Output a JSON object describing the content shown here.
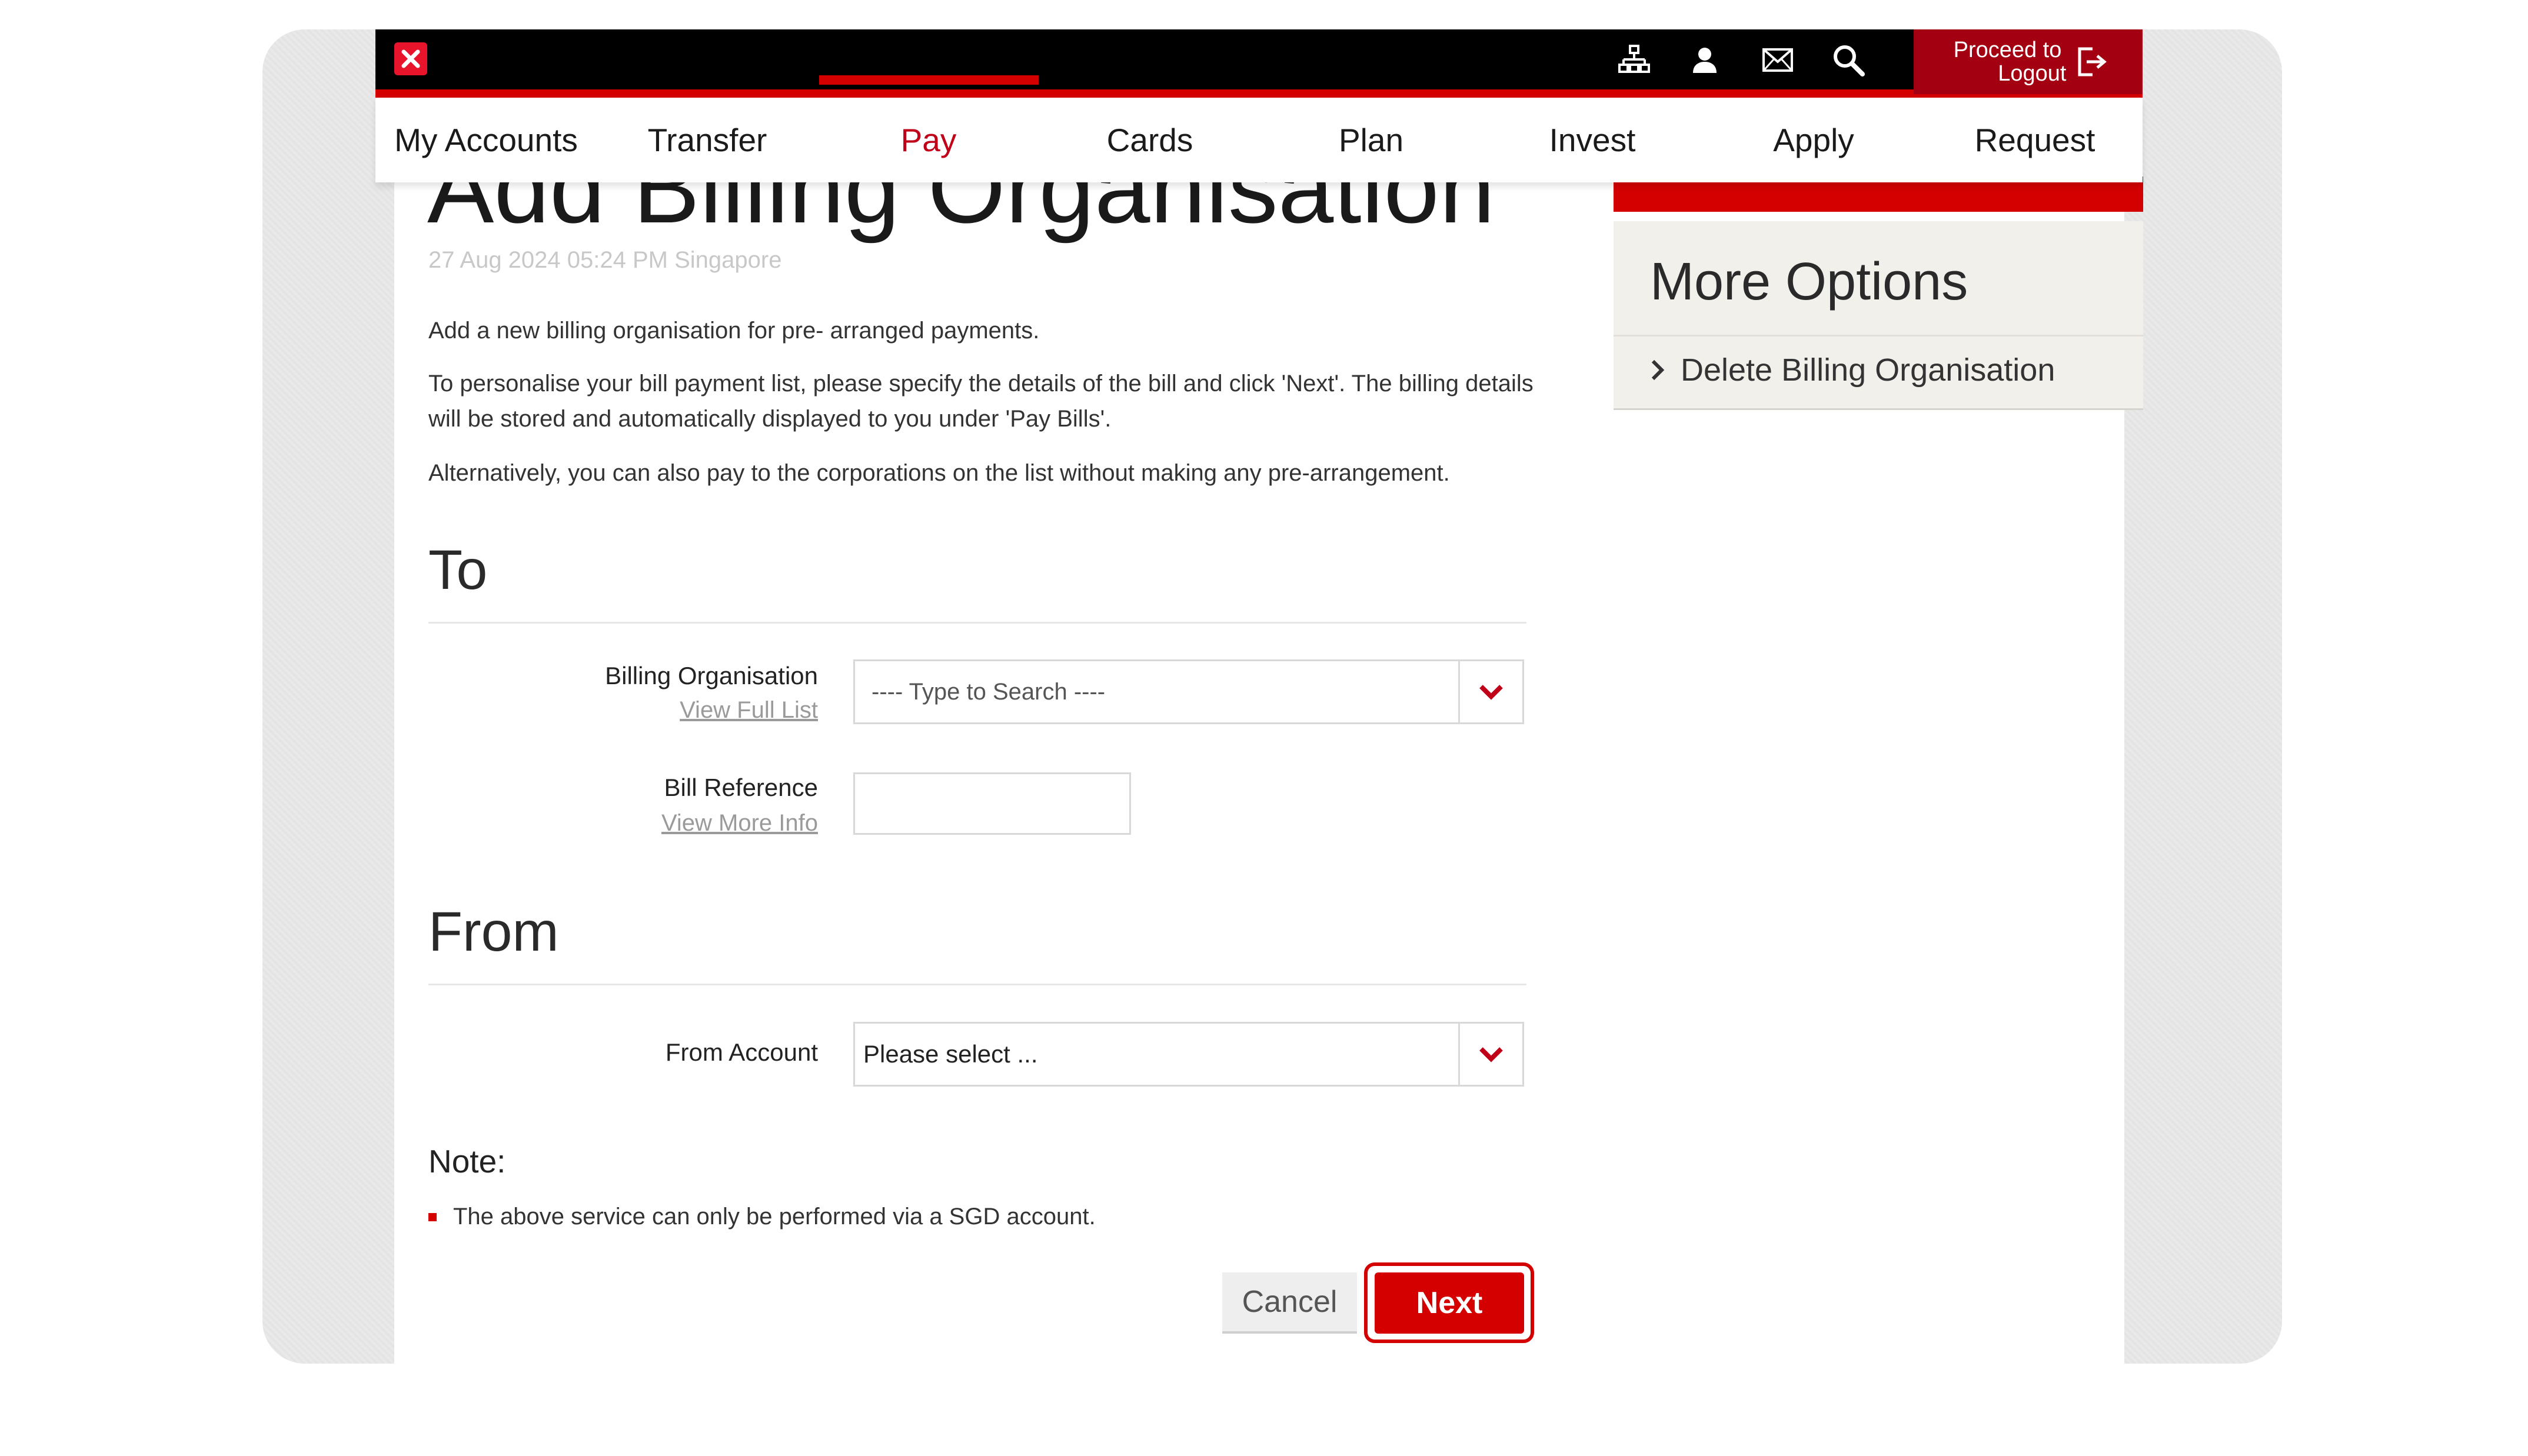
{
  "header": {
    "logout_label_line1": "Proceed to",
    "logout_label_line2": "Logout",
    "icons": [
      "sitemap-icon",
      "user-icon",
      "mail-icon",
      "search-icon",
      "logout-icon"
    ]
  },
  "nav": {
    "items": [
      {
        "label": "My Accounts"
      },
      {
        "label": "Transfer"
      },
      {
        "label": "Pay"
      },
      {
        "label": "Cards"
      },
      {
        "label": "Plan"
      },
      {
        "label": "Invest"
      },
      {
        "label": "Apply"
      },
      {
        "label": "Request"
      }
    ],
    "active": "Pay"
  },
  "page": {
    "title": "Add Billing Organisation",
    "timestamp": "27 Aug 2024 05:24 PM Singapore",
    "intro": [
      "Add a new billing organisation for pre- arranged payments.",
      "To personalise your bill payment list, please specify the details of the bill and click 'Next'. The billing details will be stored and automatically displayed to you under 'Pay Bills'.",
      "Alternatively, you can also pay to the corporations on the list without making any pre-arrangement."
    ]
  },
  "to_section": {
    "title": "To",
    "billing_org_label": "Billing Organisation",
    "billing_org_link": "View Full List",
    "billing_org_placeholder": "---- Type to Search ----",
    "bill_ref_label": "Bill Reference",
    "bill_ref_link": "View More Info",
    "bill_ref_value": ""
  },
  "from_section": {
    "title": "From",
    "from_account_label": "From Account",
    "from_account_value": "Please select ..."
  },
  "note": {
    "title": "Note:",
    "items": [
      "The above service can only be performed via a SGD account."
    ]
  },
  "buttons": {
    "cancel": "Cancel",
    "next": "Next"
  },
  "sidebar": {
    "title": "More Options",
    "links": [
      {
        "label": "Delete Billing Organisation"
      }
    ]
  },
  "colors": {
    "brand_red": "#d40000",
    "dark_red": "#a30011",
    "top_bar": "#000000"
  }
}
